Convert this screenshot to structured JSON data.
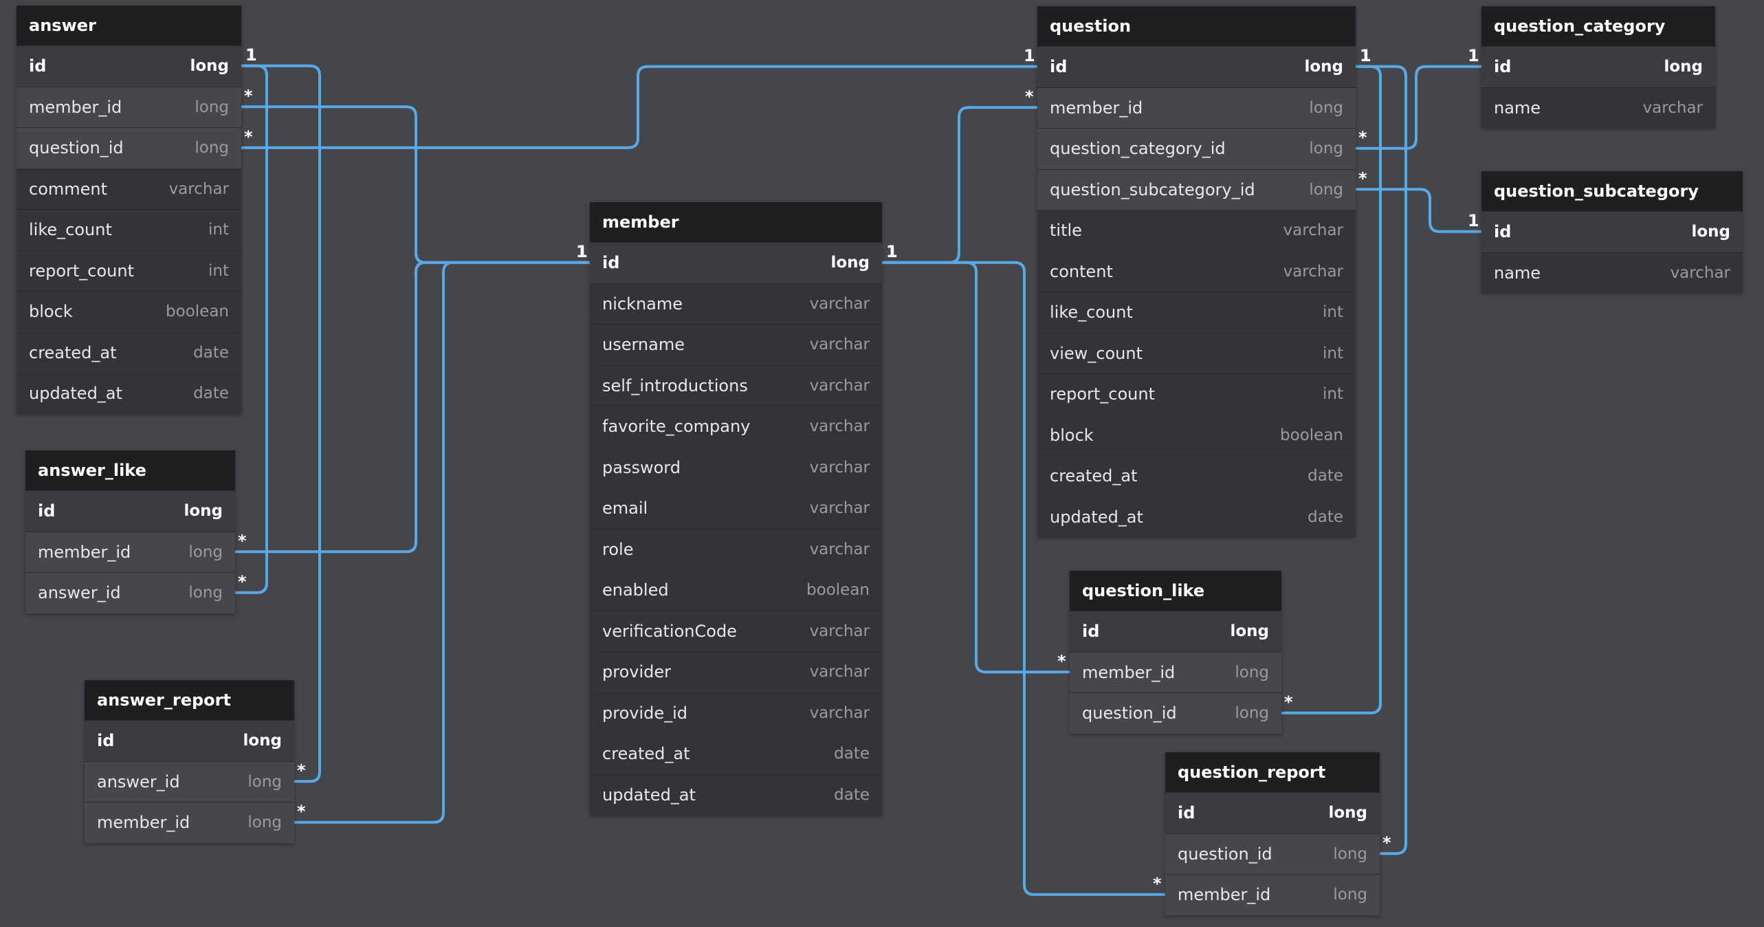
{
  "diagram": {
    "link_color": "#5aa9e6",
    "background": "#45464b",
    "tables": [
      {
        "id": "answer",
        "name": "answer",
        "fields": [
          {
            "name": "id",
            "type": "long"
          },
          {
            "name": "member_id",
            "type": "long"
          },
          {
            "name": "question_id",
            "type": "long"
          },
          {
            "name": "comment",
            "type": "varchar"
          },
          {
            "name": "like_count",
            "type": "int"
          },
          {
            "name": "report_count",
            "type": "int"
          },
          {
            "name": "block",
            "type": "boolean"
          },
          {
            "name": "created_at",
            "type": "date"
          },
          {
            "name": "updated_at",
            "type": "date"
          }
        ]
      },
      {
        "id": "answer_like",
        "name": "answer_like",
        "fields": [
          {
            "name": "id",
            "type": "long"
          },
          {
            "name": "member_id",
            "type": "long"
          },
          {
            "name": "answer_id",
            "type": "long"
          }
        ]
      },
      {
        "id": "answer_report",
        "name": "answer_report",
        "fields": [
          {
            "name": "id",
            "type": "long"
          },
          {
            "name": "answer_id",
            "type": "long"
          },
          {
            "name": "member_id",
            "type": "long"
          }
        ]
      },
      {
        "id": "member",
        "name": "member",
        "fields": [
          {
            "name": "id",
            "type": "long"
          },
          {
            "name": "nickname",
            "type": "varchar"
          },
          {
            "name": "username",
            "type": "varchar"
          },
          {
            "name": "self_introductions",
            "type": "varchar"
          },
          {
            "name": "favorite_company",
            "type": "varchar"
          },
          {
            "name": "password",
            "type": "varchar"
          },
          {
            "name": "email",
            "type": "varchar"
          },
          {
            "name": "role",
            "type": "varchar"
          },
          {
            "name": "enabled",
            "type": "boolean"
          },
          {
            "name": "verificationCode",
            "type": "varchar"
          },
          {
            "name": "provider",
            "type": "varchar"
          },
          {
            "name": "provide_id",
            "type": "varchar"
          },
          {
            "name": "created_at",
            "type": "date"
          },
          {
            "name": "updated_at",
            "type": "date"
          }
        ]
      },
      {
        "id": "question",
        "name": "question",
        "fields": [
          {
            "name": "id",
            "type": "long"
          },
          {
            "name": "member_id",
            "type": "long"
          },
          {
            "name": "question_category_id",
            "type": "long"
          },
          {
            "name": "question_subcategory_id",
            "type": "long"
          },
          {
            "name": "title",
            "type": "varchar"
          },
          {
            "name": "content",
            "type": "varchar"
          },
          {
            "name": "like_count",
            "type": "int"
          },
          {
            "name": "view_count",
            "type": "int"
          },
          {
            "name": "report_count",
            "type": "int"
          },
          {
            "name": "block",
            "type": "boolean"
          },
          {
            "name": "created_at",
            "type": "date"
          },
          {
            "name": "updated_at",
            "type": "date"
          }
        ]
      },
      {
        "id": "question_category",
        "name": "question_category",
        "fields": [
          {
            "name": "id",
            "type": "long"
          },
          {
            "name": "name",
            "type": "varchar"
          }
        ]
      },
      {
        "id": "question_subcategory",
        "name": "question_subcategory",
        "fields": [
          {
            "name": "id",
            "type": "long"
          },
          {
            "name": "name",
            "type": "varchar"
          }
        ]
      },
      {
        "id": "question_like",
        "name": "question_like",
        "fields": [
          {
            "name": "id",
            "type": "long"
          },
          {
            "name": "member_id",
            "type": "long"
          },
          {
            "name": "question_id",
            "type": "long"
          }
        ]
      },
      {
        "id": "question_report",
        "name": "question_report",
        "fields": [
          {
            "name": "id",
            "type": "long"
          },
          {
            "name": "question_id",
            "type": "long"
          },
          {
            "name": "member_id",
            "type": "long"
          }
        ]
      }
    ],
    "relations": [
      {
        "from": "answer.member_id",
        "to": "member.id",
        "from_card": "*",
        "to_card": "1"
      },
      {
        "from": "answer.question_id",
        "to": "question.id",
        "from_card": "*",
        "to_card": "1"
      },
      {
        "from": "answer_like.member_id",
        "to": "member.id",
        "from_card": "*",
        "to_card": "1"
      },
      {
        "from": "answer_like.answer_id",
        "to": "answer.id",
        "from_card": "*",
        "to_card": "1"
      },
      {
        "from": "answer_report.answer_id",
        "to": "answer.id",
        "from_card": "*",
        "to_card": "1"
      },
      {
        "from": "answer_report.member_id",
        "to": "member.id",
        "from_card": "*",
        "to_card": "1"
      },
      {
        "from": "question.member_id",
        "to": "member.id",
        "from_card": "*",
        "to_card": "1"
      },
      {
        "from": "question.question_category_id",
        "to": "question_category.id",
        "from_card": "*",
        "to_card": "1"
      },
      {
        "from": "question.question_subcategory_id",
        "to": "question_subcategory.id",
        "from_card": "*",
        "to_card": "1"
      },
      {
        "from": "question_like.member_id",
        "to": "member.id",
        "from_card": "*",
        "to_card": "1"
      },
      {
        "from": "question_like.question_id",
        "to": "question.id",
        "from_card": "*",
        "to_card": "1"
      },
      {
        "from": "question_report.question_id",
        "to": "question.id",
        "from_card": "*",
        "to_card": "1"
      },
      {
        "from": "question_report.member_id",
        "to": "member.id",
        "from_card": "*",
        "to_card": "1"
      }
    ]
  }
}
